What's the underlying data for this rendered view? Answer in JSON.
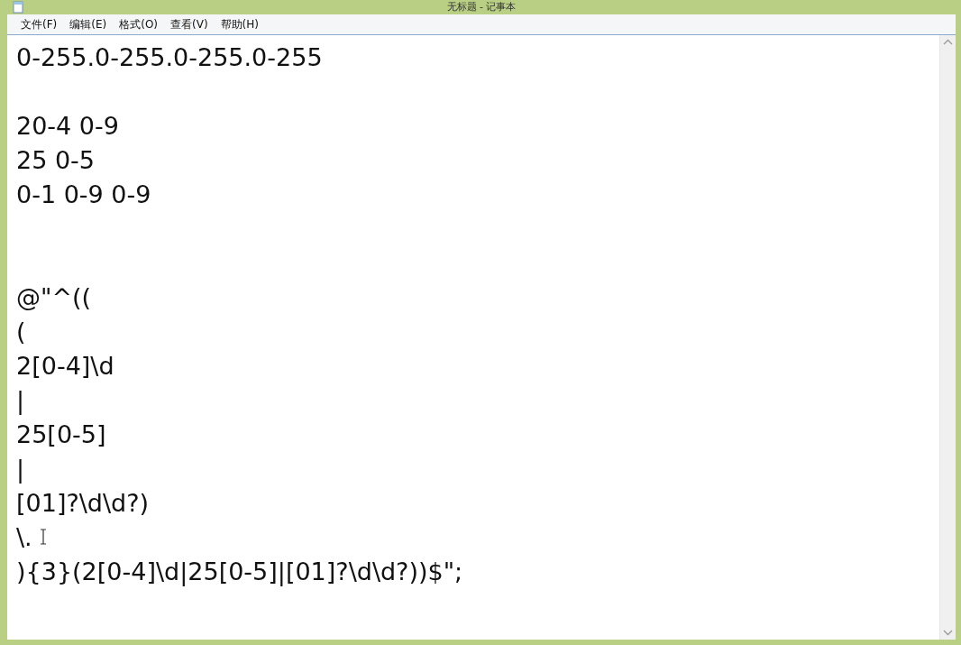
{
  "window": {
    "title": "无标题 - 记事本"
  },
  "menu": [
    "文件(F)",
    "编辑(E)",
    "格式(O)",
    "查看(V)",
    "帮助(H)"
  ],
  "editor": {
    "text": "0-255.0-255.0-255.0-255\n\n20-4 0-9\n25 0-5\n0-1 0-9 0-9\n\n\n@\"^((\n(\n2[0-4]\\d\n|\n25[0-5]\n|\n[01]?\\d\\d?)\n\\.\n){3}(2[0-4]\\d|25[0-5]|[01]?\\d\\d?))$\";"
  }
}
